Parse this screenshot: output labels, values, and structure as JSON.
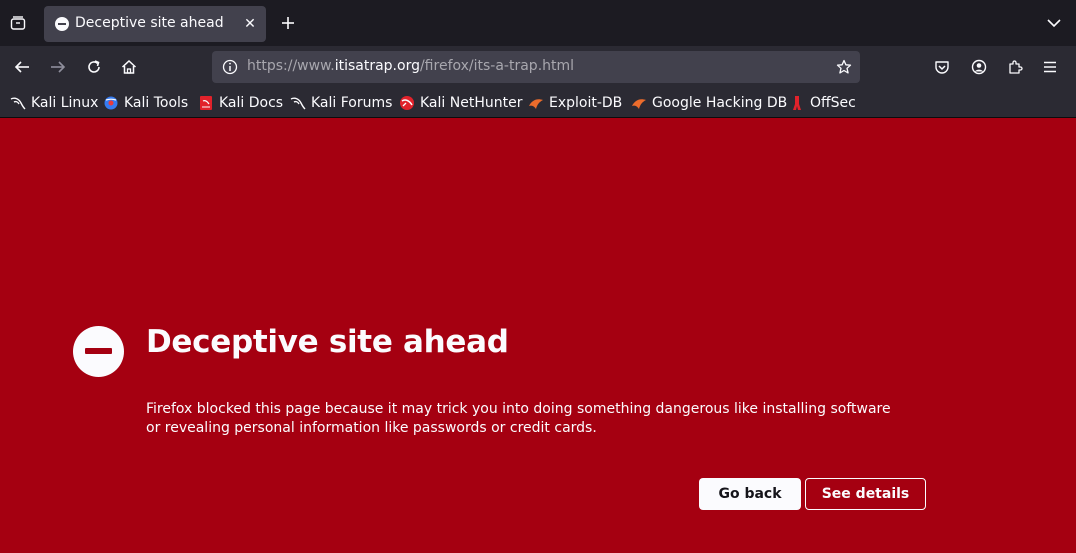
{
  "tab": {
    "title": "Deceptive site ahead",
    "close_glyph": "✕"
  },
  "url": {
    "scheme": "https://www.",
    "host": "itisatrap.org",
    "path": "/firefox/its-a-trap.html"
  },
  "bookmarks": [
    {
      "label": "Kali Linux",
      "icon": "kali-dragon-icon"
    },
    {
      "label": "Kali Tools",
      "icon": "kali-tools-icon"
    },
    {
      "label": "Kali Docs",
      "icon": "kali-docs-icon"
    },
    {
      "label": "Kali Forums",
      "icon": "kali-dragon-icon"
    },
    {
      "label": "Kali NetHunter",
      "icon": "nethunter-icon"
    },
    {
      "label": "Exploit-DB",
      "icon": "exploit-db-icon"
    },
    {
      "label": "Google Hacking DB",
      "icon": "exploit-db-icon"
    },
    {
      "label": "OffSec",
      "icon": "offsec-icon"
    }
  ],
  "page": {
    "title": "Deceptive site ahead",
    "description": "Firefox blocked this page because it may trick you into doing something dangerous like installing software or revealing personal information like passwords or credit cards.",
    "go_back_label": "Go back",
    "see_details_label": "See details"
  },
  "colors": {
    "warning_background": "#a50011",
    "toolbar": "#2b2a33",
    "tabstrip": "#1c1b22",
    "urlbar": "#42414d"
  }
}
